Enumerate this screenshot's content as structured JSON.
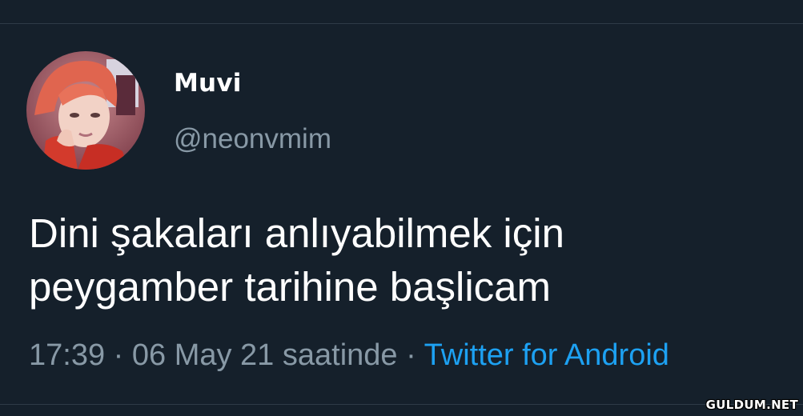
{
  "user": {
    "display_name": "Muvi",
    "handle": "@neonvmim",
    "avatar": "profile-photo-icon"
  },
  "tweet": {
    "text_line1": "Dini şakaları anlıyabilmek için",
    "text_line2": "peygamber tarihine başlicam",
    "time": "17:39",
    "date": "06 May 21",
    "date_suffix": "saatinde",
    "separator": "·",
    "source": "Twitter for Android"
  },
  "watermark": "GULDUM.NET",
  "colors": {
    "background": "#15202b",
    "primary_text": "#ffffff",
    "secondary_text": "#8899a6",
    "link": "#1da1f2",
    "divider": "#2f3b47"
  }
}
